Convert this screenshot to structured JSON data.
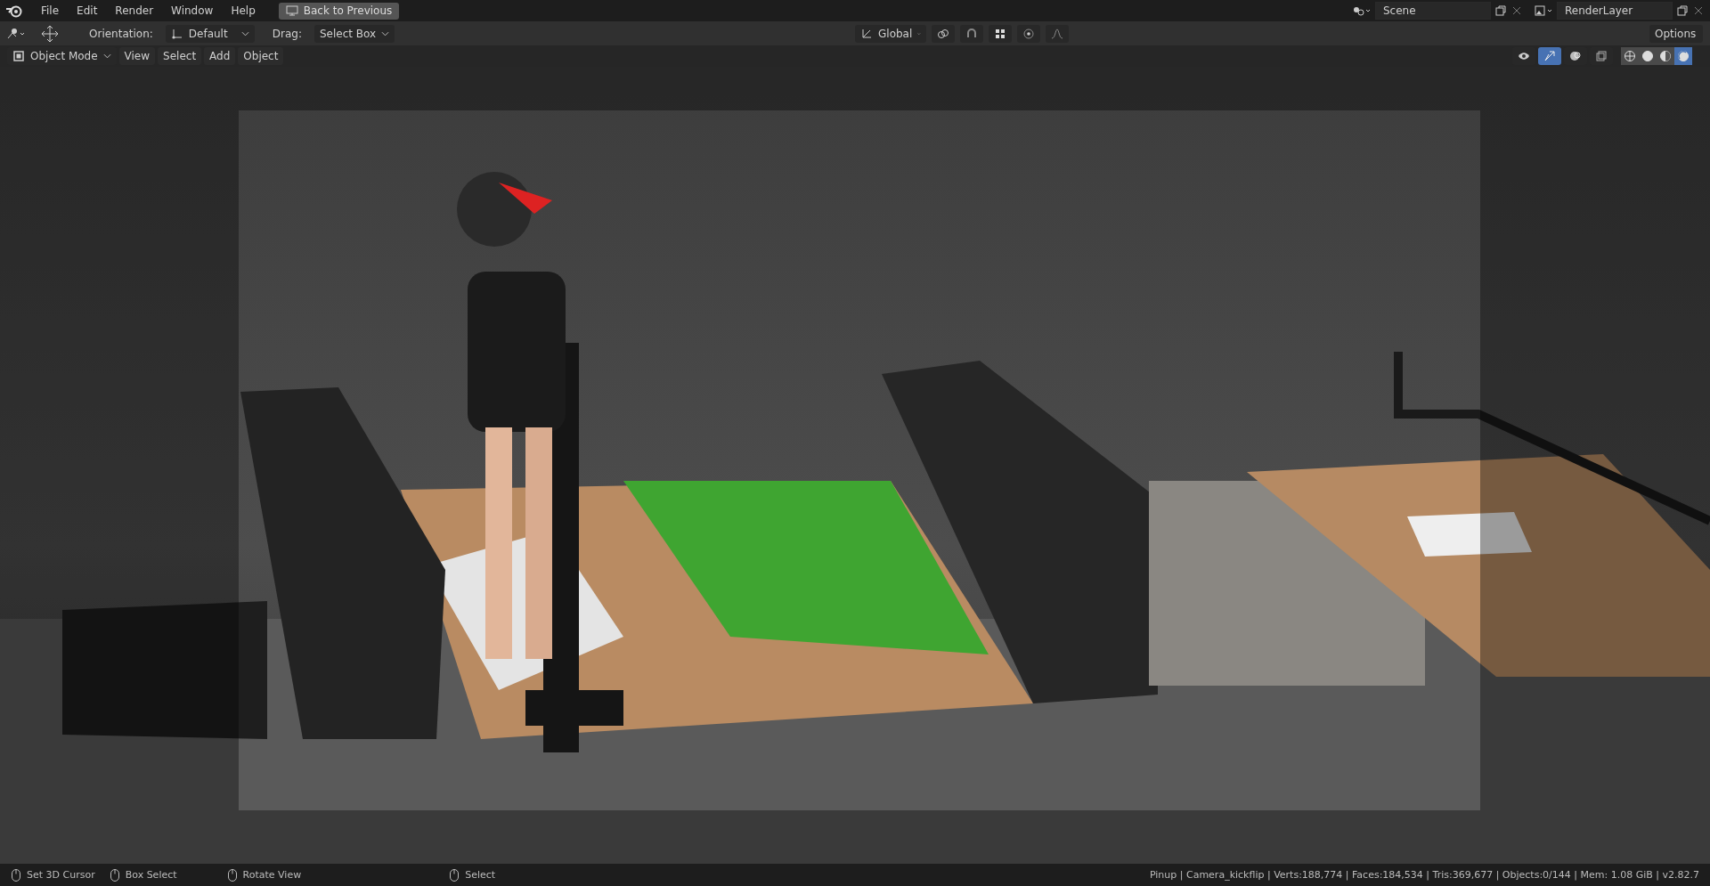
{
  "menu": [
    "File",
    "Edit",
    "Render",
    "Window",
    "Help"
  ],
  "back_button": "Back to Previous",
  "scene": {
    "value": "Scene"
  },
  "render_layer": {
    "value": "RenderLayer"
  },
  "tool_header": {
    "orientation_label": "Orientation:",
    "orientation": "Default",
    "drag_label": "Drag:",
    "drag": "Select Box",
    "transform": "Global",
    "options": "Options"
  },
  "viewport_header": {
    "mode": "Object Mode",
    "menus": [
      "View",
      "Select",
      "Add",
      "Object"
    ],
    "gizmo_on": true,
    "shading": [
      {
        "selected": false
      },
      {
        "selected": false
      },
      {
        "selected": false
      },
      {
        "selected": true
      }
    ]
  },
  "status_bar": {
    "hints": [
      "Set 3D Cursor",
      "Box Select",
      "Rotate View",
      "Select"
    ],
    "stats": "Pinup | Camera_kickflip | Verts:188,774 | Faces:184,534 | Tris:369,677 | Objects:0/144 | Mem: 1.08 GiB | v2.82.7"
  }
}
